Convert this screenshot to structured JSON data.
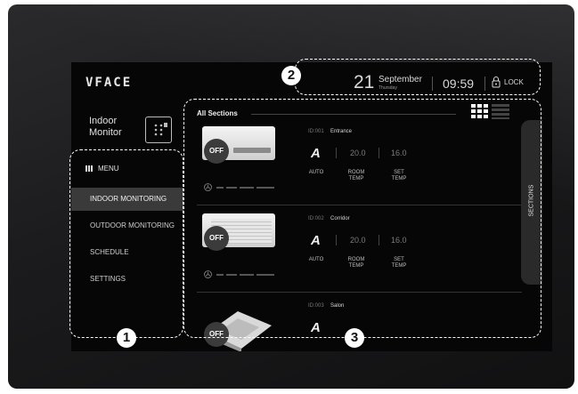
{
  "app": {
    "logo": "VFACE"
  },
  "header": {
    "date_day": "21",
    "date_month": "September",
    "date_weekday": "Thursday",
    "time": "09:59",
    "lock_label": "LOCK"
  },
  "sidebar": {
    "title": "Indoor\nMonitor",
    "menu_label": "MENU",
    "items": [
      {
        "label": "INDOOR MONITORING"
      },
      {
        "label": "OUTDOOR MONITORING"
      },
      {
        "label": "SCHEDULE"
      },
      {
        "label": "SETTINGS"
      }
    ]
  },
  "main": {
    "sections_title": "All Sections",
    "sections_tab": "SECTIONS",
    "cards": [
      {
        "id": "ID:001",
        "name": "Entrance",
        "status": "OFF",
        "mode": "A",
        "mode_label": "AUTO",
        "room_temp": "20.0",
        "room_label": "ROOM\nTEMP",
        "set_temp": "16.0",
        "set_label": "SET\nTEMP"
      },
      {
        "id": "ID:002",
        "name": "Corridor",
        "status": "OFF",
        "mode": "A",
        "mode_label": "AUTO",
        "room_temp": "20.0",
        "room_label": "ROOM\nTEMP",
        "set_temp": "16.0",
        "set_label": "SET\nTEMP"
      },
      {
        "id": "ID:003",
        "name": "Salon",
        "status": "OFF",
        "mode": "A"
      }
    ]
  },
  "callouts": [
    "1",
    "2",
    "3"
  ],
  "colors": {
    "background": "#060606",
    "active_item": "#3a3a3a",
    "callout": "#ffffff"
  }
}
